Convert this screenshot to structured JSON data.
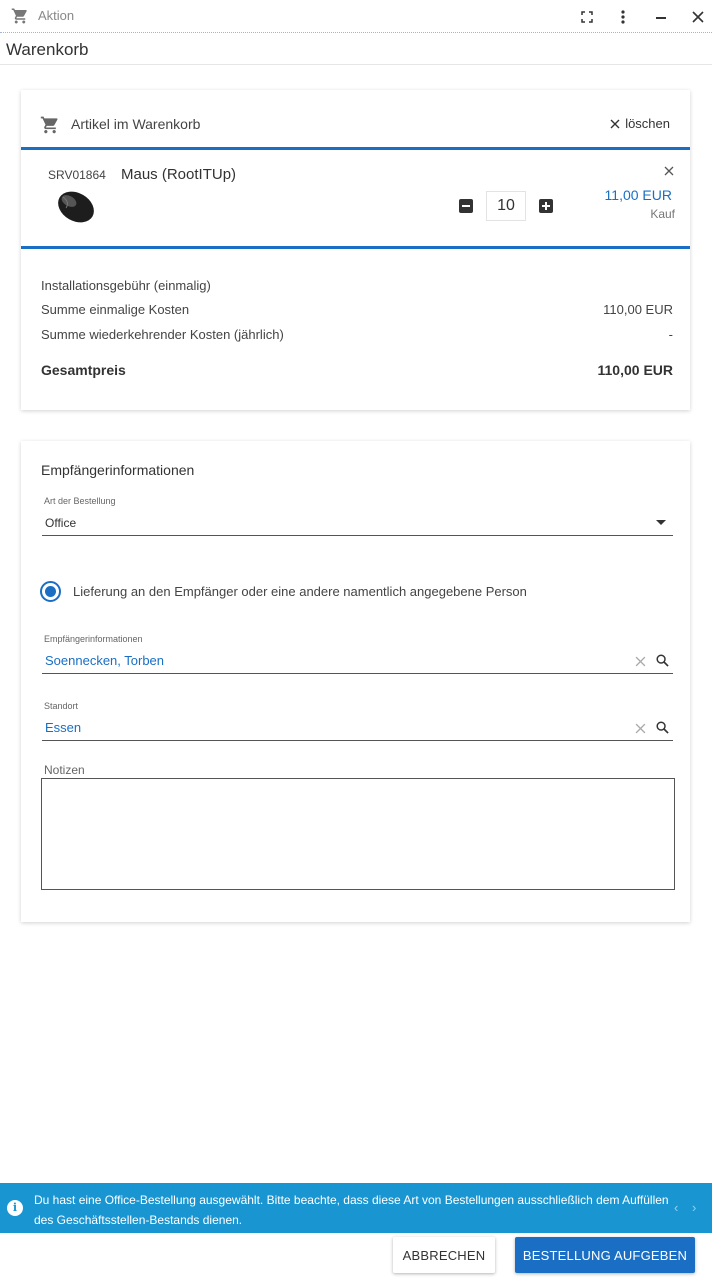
{
  "window": {
    "title": "Aktion",
    "controls": {
      "fullscreen_icon": "fullscreen-icon",
      "menu_icon": "more-vertical-icon",
      "minimize_icon": "minimize-icon",
      "close_icon": "close-icon"
    }
  },
  "page": {
    "title": "Warenkorb"
  },
  "cart": {
    "header_title": "Artikel im Warenkorb",
    "clear_label": "löschen",
    "item": {
      "sku": "SRV01864",
      "name": "Maus (RootITUp)",
      "quantity": "10",
      "price": "11,00 EUR",
      "purchase_type": "Kauf"
    },
    "summary": [
      {
        "label": "Installationsgebühr (einmalig)",
        "value": ""
      },
      {
        "label": "Summe einmalige Kosten",
        "value": "110,00 EUR"
      },
      {
        "label": "Summe wiederkehrender Kosten (jährlich)",
        "value": "-"
      }
    ],
    "total": {
      "label": "Gesamtpreis",
      "value": "110,00 EUR"
    }
  },
  "recipient": {
    "section_title": "Empfängerinformationen",
    "order_type": {
      "label": "Art der Bestellung",
      "value": "Office"
    },
    "delivery_option": "Lieferung an den Empfänger oder eine andere namentlich angegebene Person",
    "recipient_field": {
      "label": "Empfängerinformationen",
      "value": "Soennecken, Torben"
    },
    "location_field": {
      "label": "Standort",
      "value": "Essen"
    },
    "notes": {
      "label": "Notizen",
      "value": ""
    }
  },
  "info_banner": {
    "text": "Du hast eine Office-Bestellung ausgewählt. Bitte beachte, dass diese Art von Bestellungen ausschließlich dem Auffüllen des Geschäftsstellen-Bestands dienen.",
    "prev": "‹",
    "next": "›"
  },
  "actions": {
    "cancel_label": "ABBRECHEN",
    "submit_label": "BESTELLUNG AUFGEBEN"
  },
  "colors": {
    "accent": "#1a6fc4",
    "banner": "#1996d2"
  }
}
